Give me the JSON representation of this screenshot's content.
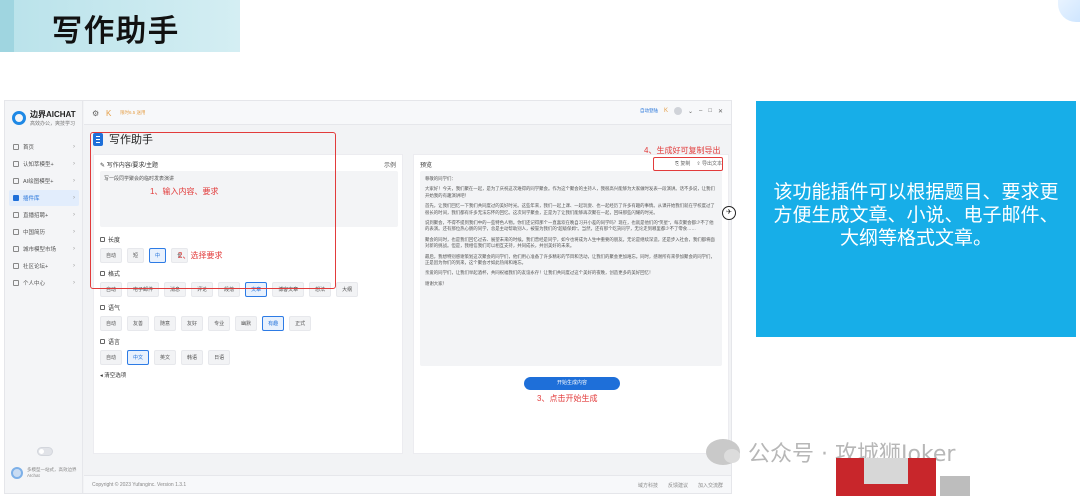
{
  "slide": {
    "title": "写作助手",
    "info_text": "该功能插件可以根据题目、要求更方便生成文章、小说、电子邮件、大纲等格式文章。",
    "watermark": "公众号 · 攻城狮Joker"
  },
  "app": {
    "brand_title": "边界AICHAT",
    "brand_subtitle": "高效办公，爽技学习",
    "top_ad": "限时6.5 送用",
    "top_right_link": "自动登陆",
    "nav": [
      {
        "label": "首页"
      },
      {
        "label": "认知萃模型+"
      },
      {
        "label": "AI绘图模型+"
      },
      {
        "label": "插件库"
      },
      {
        "label": "直播招聘+"
      },
      {
        "label": "中国简历"
      },
      {
        "label": "城市模型市场"
      },
      {
        "label": "社区论坛+"
      },
      {
        "label": "个人中心"
      }
    ],
    "side_footer": "多模型一站式，高效边界AIchat",
    "page_title": "写作助手",
    "left": {
      "header": "写作内容/要求/主题",
      "example": "示例",
      "topic_value": "写一段同学聚会的临时发表演讲",
      "groups": [
        {
          "label": "长度",
          "options": [
            "自动",
            "短",
            "中",
            "长"
          ],
          "selected": "中"
        },
        {
          "label": "格式",
          "options": [
            "自动",
            "电子邮件",
            "消息",
            "评论",
            "段落",
            "文章",
            "博客文章",
            "想法",
            "大纲"
          ],
          "selected": "文章"
        },
        {
          "label": "语气",
          "options": [
            "自动",
            "友善",
            "随意",
            "友好",
            "专业",
            "幽默",
            "有趣",
            "正式"
          ],
          "selected": "有趣"
        },
        {
          "label": "语言",
          "options": [
            "自动",
            "中文",
            "英文",
            "韩语",
            "日语"
          ],
          "selected": "中文"
        }
      ],
      "clear_label": "清空选项"
    },
    "right": {
      "header": "预览",
      "copy_label": "复制",
      "export_label": "导出文本",
      "paragraphs": [
        "尊敬的同学们：",
        "大家好！今天，我们聚在一起，是为了庆祝这次难得的同学聚会。作为这个聚会的主持人，我很高兴能够为大家做时发表一段演讲。话不多说，让我们开始我的有趣演讲吧！",
        "首先，让我们回忆一下我们共同度过的美好时光。这些年来，我们一起上课、一起玩耍、也一起经历了许多有趣的事情。从课开始我们就在学校度过了很长的时间，我们都有许多无法忘怀的回忆。这次同学聚会，正是为了让我们能够再次聚在一起，回味那些闪耀的时光。",
        "说到聚会，不得不提到我们中的一些特色人物。你们还记得那个一直喜欢在晚自习开小差的同学吗？现在，也就是他们的\"笑星\"，每次聚会都少不了他的表演。还有那位热心肠的同学，总是主动帮助别人，被誉为我们的\"超级保姆\"。当然，还有那个吃货同学，无论走到哪里都少不了零食……",
        "聚会的同时，也是我们回忆过去、展望未来的时候。我们曾经是同学，如今也将成为人生中重要的朋友。无论是继续深造，还是步入社会，我们都将面对新的挑战。但是，我相信我们可以相互支持，共同成长，共创美好的未来。",
        "最后，我想特别感谢策划这次聚会的同学们，他们用心准备了许多精彩的节目和活动，让我们的聚会更加难忘。同时，感谢所有来参加聚会的同学们，正是因为你们的到来，这个聚会才如此热闹和难忘。",
        "亲爱的同学们，让我们举起酒杯，共同祝福我们的友谊永存！让我们共同度过这个美好的夜晚，创造更多的美好回忆！",
        "谢谢大家！"
      ],
      "generate_label": "开始生成内容"
    },
    "footer": {
      "copyright": "Copyright © 2023 Yufanginc. Version 1.3.1",
      "links": [
        "域方科技",
        "反馈建议",
        "加入交流群"
      ]
    }
  },
  "annotations": {
    "step1": "1、输入内容、要求",
    "step2": "2、选择要求",
    "step3": "3、点击开始生成",
    "step4": "4、生成好可复制导出"
  },
  "colors": {
    "accent": "#1e6fd9",
    "annotation": "#e23b3b",
    "info_box": "#17aee8"
  }
}
